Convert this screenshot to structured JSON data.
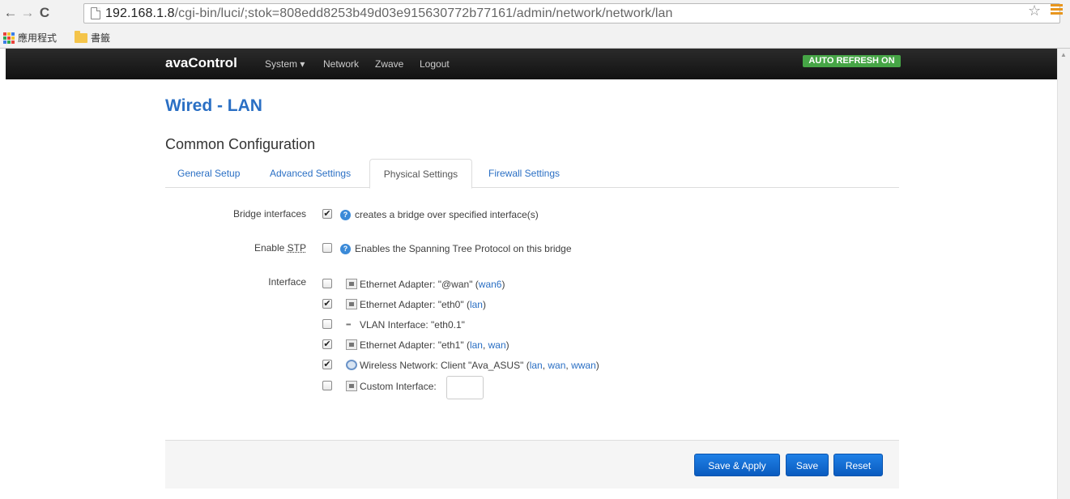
{
  "browser": {
    "url_host": "192.168.1.8",
    "url_path": "/cgi-bin/luci/;stok=808edd8253b49d03e915630772b77161/admin/network/network/lan",
    "bookmarks": [
      {
        "label": "應用程式",
        "icon": "apps-icon"
      },
      {
        "label": "書籤",
        "icon": "folder-icon"
      }
    ],
    "apps_icon_colors": [
      "#e8453c",
      "#f4c22b",
      "#3a7ee6",
      "#2fa84f",
      "#e8453c",
      "#f4c22b",
      "#3a7ee6",
      "#2fa84f",
      "#e8453c"
    ],
    "menu_color": "#e8961e"
  },
  "navbar": {
    "brand": "avaControl",
    "links": [
      "System",
      "Network",
      "Zwave",
      "Logout"
    ],
    "system_caret": "▾",
    "auto_refresh": "AUTO REFRESH ON",
    "auto_refresh_color": "#46a546"
  },
  "page": {
    "title": "Wired - LAN",
    "section": "Common Configuration",
    "tabs": [
      "General Setup",
      "Advanced Settings",
      "Physical Settings",
      "Firewall Settings"
    ],
    "active_tab": "Physical Settings",
    "accent_color": "#2a6fc4"
  },
  "form": {
    "bridge": {
      "label": "Bridge interfaces",
      "checked": true,
      "desc": "creates a bridge over specified interface(s)"
    },
    "stp": {
      "label_prefix": "Enable ",
      "label_abbr": "STP",
      "checked": false,
      "desc": "Enables the Spanning Tree Protocol on this bridge"
    },
    "interface_label": "Interface",
    "interfaces": [
      {
        "checked": false,
        "icon": "ethernet-icon",
        "text": "Ethernet Adapter: \"@wan\"",
        "open": " (",
        "networks": [
          "wan6"
        ],
        "close": ")"
      },
      {
        "checked": true,
        "icon": "ethernet-icon",
        "text": "Ethernet Adapter: \"eth0\"",
        "open": " (",
        "networks": [
          "lan"
        ],
        "close": ")"
      },
      {
        "checked": false,
        "icon": "vlan-icon",
        "text": "VLAN Interface: \"eth0.1\"",
        "open": "",
        "networks": [],
        "close": ""
      },
      {
        "checked": true,
        "icon": "ethernet-icon",
        "text": "Ethernet Adapter: \"eth1\"",
        "open": " (",
        "networks": [
          "lan",
          "wan"
        ],
        "close": ")"
      },
      {
        "checked": true,
        "icon": "wifi-icon",
        "text": "Wireless Network: Client \"Ava_ASUS\"",
        "open": " (",
        "networks": [
          "lan",
          "wan",
          "wwan"
        ],
        "close": ")"
      }
    ],
    "custom": {
      "checked": false,
      "label": "Custom Interface:",
      "value": ""
    }
  },
  "footer": {
    "save_apply": "Save & Apply",
    "save": "Save",
    "reset": "Reset",
    "button_color": "#0b6ad4"
  }
}
